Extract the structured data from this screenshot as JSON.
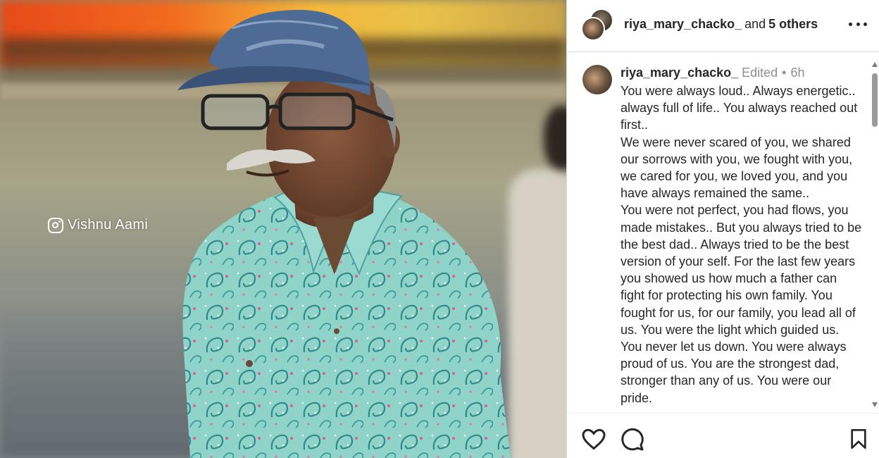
{
  "photo": {
    "watermark_text": "Vishnu Aami",
    "watermark_icon": "instagram-icon"
  },
  "header": {
    "username": "riya_mary_chacko_",
    "and_text": "and",
    "others_text": "5 others",
    "more_icon": "more-options-icon"
  },
  "caption": {
    "username": "riya_mary_chacko_",
    "edited": "Edited",
    "separator": "•",
    "time": "6h",
    "paragraphs": [
      "You were always loud.. Always energetic.. always full of life.. You always reached out first..",
      "We were never scared of you, we shared our sorrows with you, we fought with you, we cared for you, we loved you, and you have always remained the same..",
      "You were not perfect, you had flows, you made mistakes.. But you always tried to be the best dad.. Always tried to be the best version of your self. For the last few years you showed us how much a father can fight for protecting his own family. You fought for us, for our family, you lead all of us. You were the light which guided us.",
      "You never let us down. You were always proud of us. You are the strongest dad, stronger than any of us. You were our pride."
    ]
  },
  "actions": {
    "like_icon": "heart-icon",
    "comment_icon": "comment-icon",
    "save_icon": "bookmark-icon"
  },
  "colors": {
    "text": "#262626",
    "muted": "#8e8e8e",
    "divider": "#dbdbdb"
  }
}
